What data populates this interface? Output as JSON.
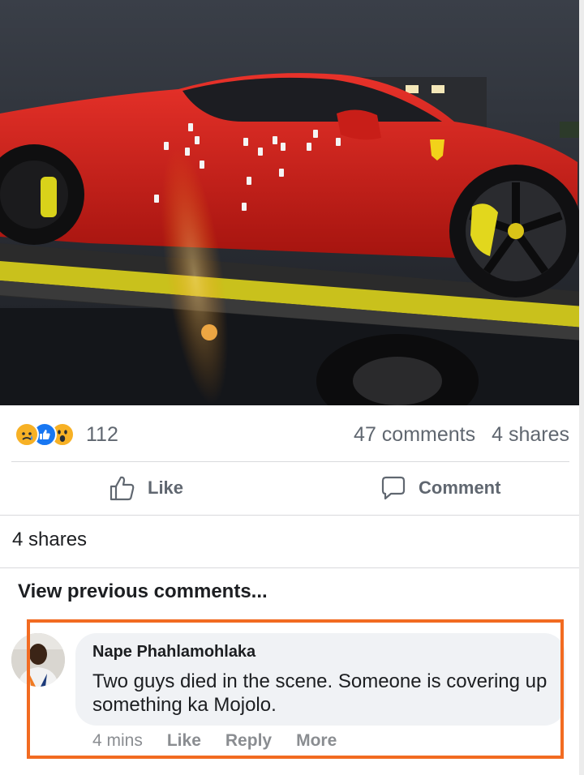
{
  "post": {
    "reactions": {
      "icons": [
        "sad-reaction",
        "like-reaction",
        "wow-reaction"
      ],
      "count": "112"
    },
    "comments_count": "47 comments",
    "shares_count": "4 shares",
    "actions": {
      "like_label": "Like",
      "comment_label": "Comment"
    },
    "shares_line": "4 shares",
    "view_previous": "View previous comments..."
  },
  "comment": {
    "author": "Nape Phahlamohlaka",
    "text": "Two guys died in the scene. Someone is covering up something ka Mojolo.",
    "time": "4 mins",
    "like_label": "Like",
    "reply_label": "Reply",
    "more_label": "More"
  },
  "colors": {
    "highlight_border": "#f26b21",
    "bubble_bg": "#f0f2f5",
    "meta_text": "#8a8d91",
    "like_blue": "#1877f2",
    "car_red": "#d3201b"
  }
}
